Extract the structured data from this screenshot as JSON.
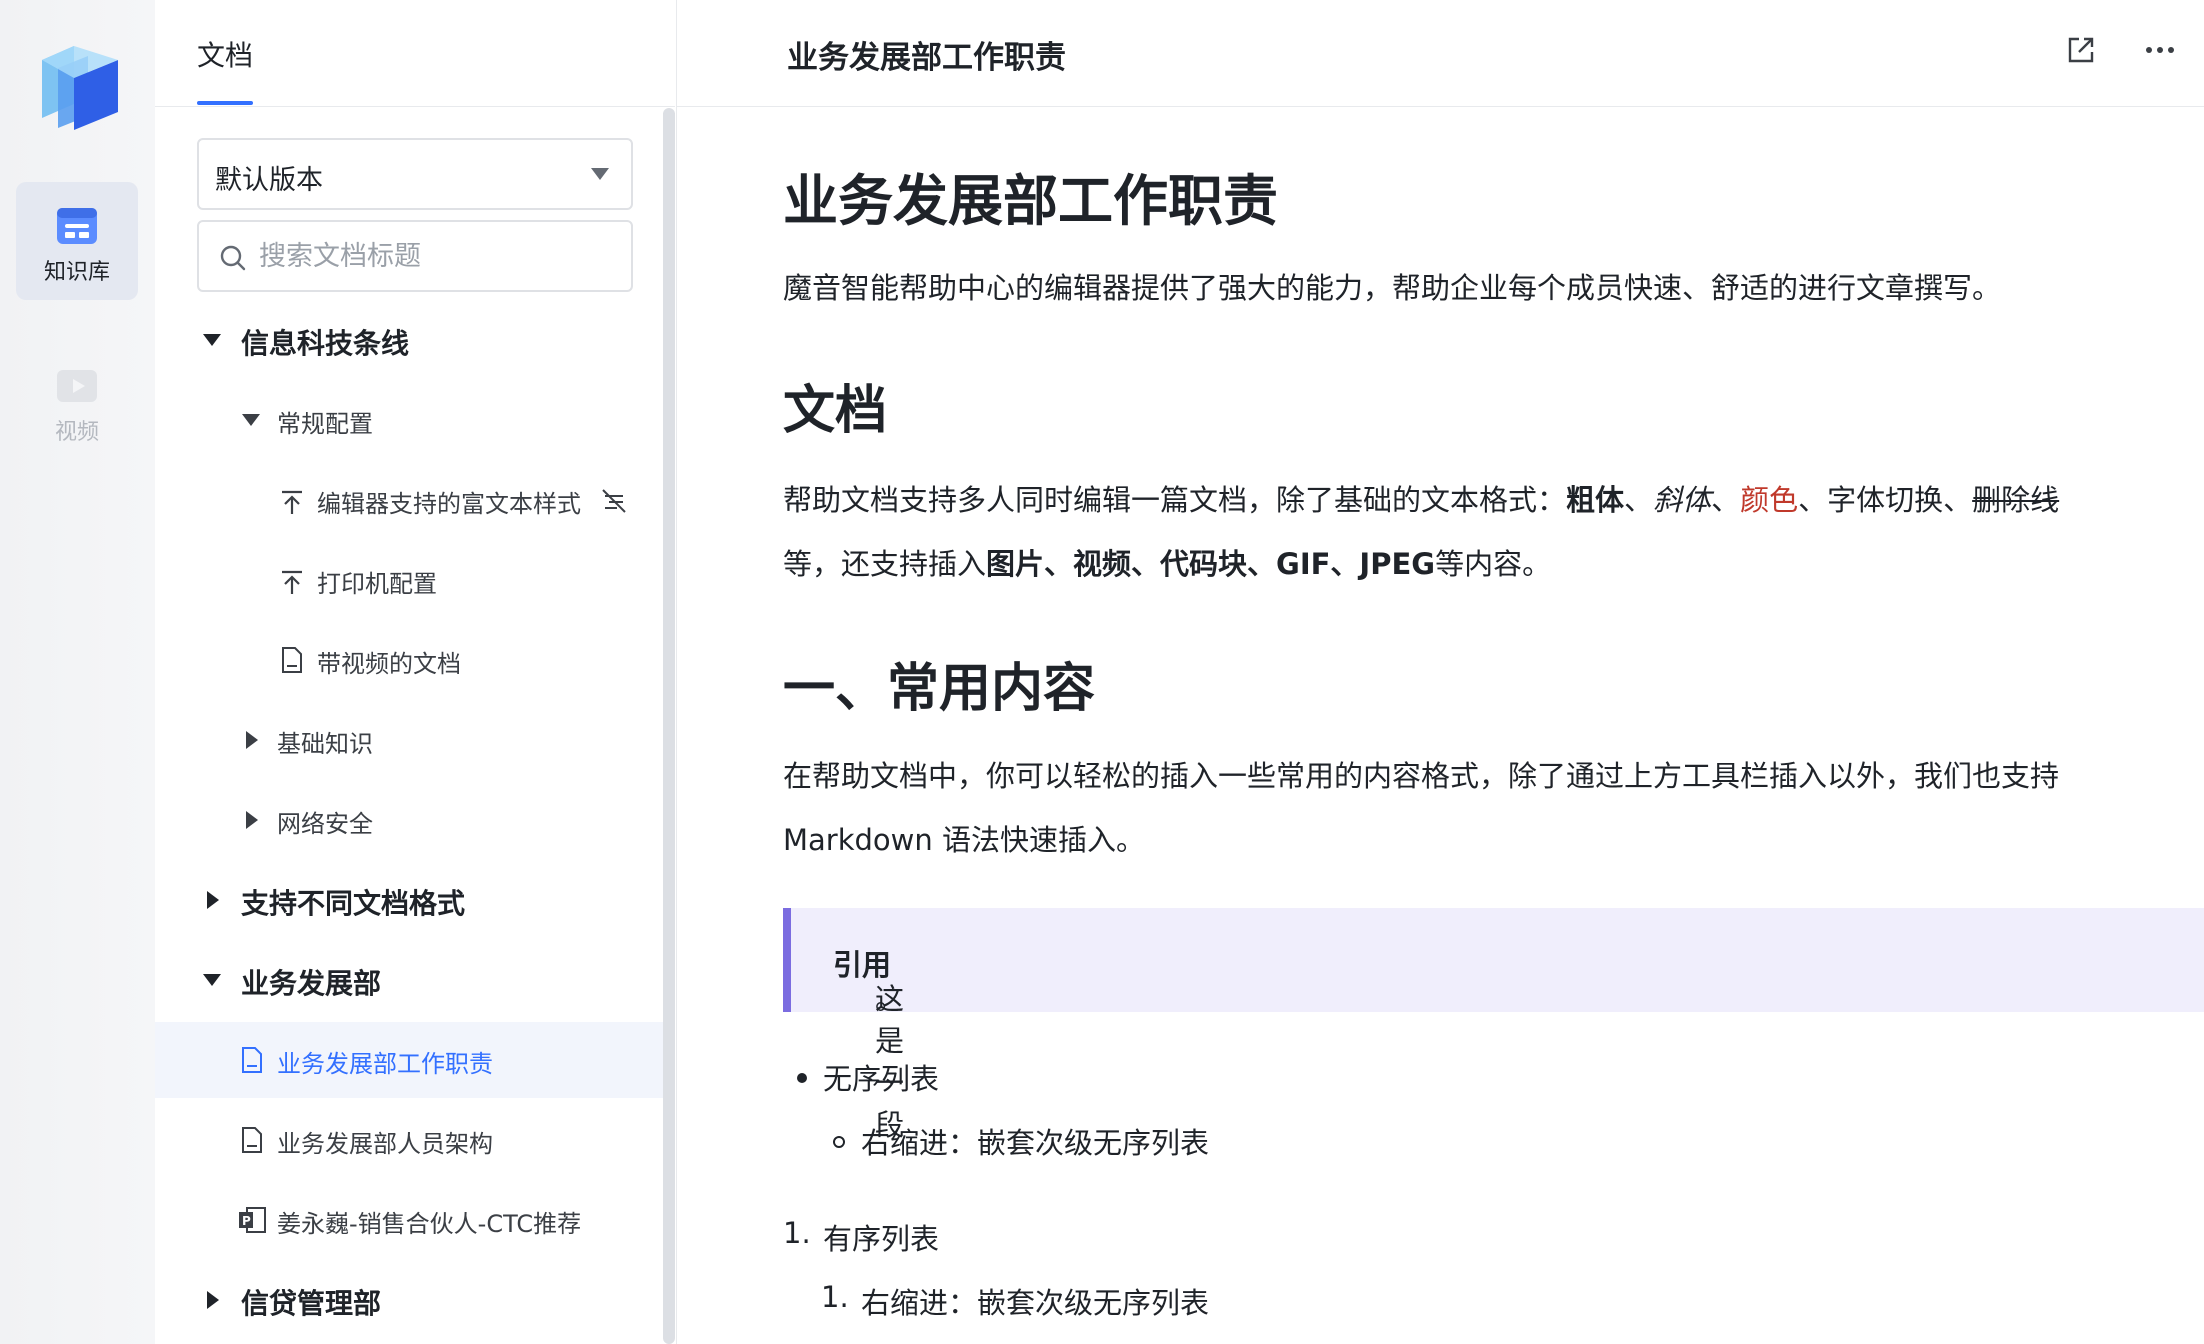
{
  "rail": {
    "items": [
      {
        "label": "知识库",
        "icon": "knowledge-base-icon",
        "active": true
      },
      {
        "label": "视频",
        "icon": "video-icon",
        "active": false
      }
    ]
  },
  "sidebar": {
    "tab": "文档",
    "version_select": "默认版本",
    "search_placeholder": "搜索文档标题",
    "tree": [
      {
        "label": "信息科技条线",
        "level": 0,
        "state": "expanded"
      },
      {
        "label": "常规配置",
        "level": 1,
        "state": "expanded"
      },
      {
        "label": "编辑器支持的富文本样式",
        "level": 2,
        "icon": "pinned-icon",
        "trailing_icon": "hidden-icon"
      },
      {
        "label": "打印机配置",
        "level": 2,
        "icon": "pinned-icon"
      },
      {
        "label": "带视频的文档",
        "level": 2,
        "icon": "document-icon"
      },
      {
        "label": "基础知识",
        "level": 1,
        "state": "collapsed"
      },
      {
        "label": "网络安全",
        "level": 1,
        "state": "collapsed"
      },
      {
        "label": "支持不同文档格式",
        "level": 0,
        "state": "collapsed"
      },
      {
        "label": "业务发展部",
        "level": 0,
        "state": "expanded"
      },
      {
        "label": "业务发展部工作职责",
        "level": 1,
        "icon": "document-icon",
        "selected": true
      },
      {
        "label": "业务发展部人员架构",
        "level": 1,
        "icon": "document-icon"
      },
      {
        "label": "姜永巍-销售合伙人-CTC推荐",
        "level": 1,
        "icon": "ppt-file-icon"
      },
      {
        "label": "信贷管理部",
        "level": 0,
        "state": "collapsed"
      }
    ]
  },
  "topbar": {
    "title": "业务发展部工作职责"
  },
  "doc": {
    "h1": "业务发展部工作职责",
    "intro": "魔音智能帮助中心的编辑器提供了强大的能力，帮助企业每个成员快速、舒适的进行文章撰写。",
    "h2_doc": "文档",
    "doc_p1": {
      "prefix": "帮助文档支持多人同时编辑一篇文档，除了基础的文本格式：",
      "bold": "粗体",
      "sep1": "、",
      "italic": "斜体",
      "sep2": "、",
      "color": "颜色",
      "sep3": "、",
      "font": "字体切换",
      "sep4": "、",
      "strike": "删除线"
    },
    "doc_p2": {
      "prefix": "等，还支持插入",
      "b1": "图片、视频、代码块、GIF、JPEG",
      "suffix": "等内容。"
    },
    "h2_common": "一、常用内容",
    "common_p1": "在帮助文档中，你可以轻松的插入一些常用的内容格式，除了通过上方工具栏插入以外，我们也支持",
    "common_p2": "Markdown 语法快速插入。",
    "quote": {
      "prefix": "这是一段",
      "bold": "引用",
      "suffix": "。"
    },
    "ul": {
      "item": "无序列表",
      "sub": "右缩进：嵌套次级无序列表"
    },
    "ol": {
      "num": "1.",
      "item": "有序列表",
      "sub_num": "1.",
      "sub": "右缩进：嵌套次级无序列表"
    }
  }
}
